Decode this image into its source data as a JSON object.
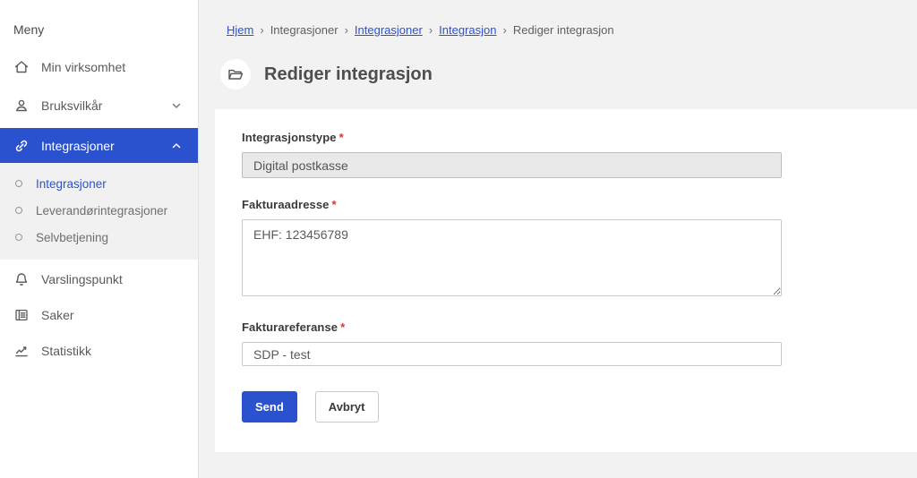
{
  "colors": {
    "accent": "#2b52ce",
    "required": "#e03131",
    "sidebar_active_bg": "#2b52ce",
    "main_background": "#f2f2f2",
    "disabled_input_bg": "#e9e9e9"
  },
  "sidebar": {
    "menu_label": "Meny",
    "items": [
      {
        "label": "Min virksomhet",
        "icon": "home-icon"
      },
      {
        "label": "Bruksvilkår",
        "icon": "person-icon",
        "chevron": "down"
      },
      {
        "label": "Integrasjoner",
        "icon": "link-icon",
        "chevron": "up",
        "active": true
      },
      {
        "label": "Varslingspunkt",
        "icon": "bell-icon"
      },
      {
        "label": "Saker",
        "icon": "list-icon"
      },
      {
        "label": "Statistikk",
        "icon": "chart-icon"
      }
    ],
    "submenu": [
      {
        "label": "Integrasjoner",
        "active": true
      },
      {
        "label": "Leverandørintegrasjoner",
        "active": false
      },
      {
        "label": "Selvbetjening",
        "active": false
      }
    ]
  },
  "breadcrumb": {
    "separator": "›",
    "items": [
      {
        "label": "Hjem",
        "link": true
      },
      {
        "label": "Integrasjoner",
        "link": false
      },
      {
        "label": "Integrasjoner",
        "link": true
      },
      {
        "label": "Integrasjon",
        "link": true
      },
      {
        "label": "Rediger integrasjon",
        "link": false
      }
    ]
  },
  "page": {
    "title": "Rediger integrasjon",
    "title_icon": "folder-open-icon"
  },
  "form": {
    "integrasjonstype": {
      "label": "Integrasjonstype",
      "required_marker": "*",
      "value": "Digital postkasse",
      "disabled": true
    },
    "fakturaadresse": {
      "label": "Fakturaadresse",
      "required_marker": "*",
      "value": "EHF: 123456789"
    },
    "fakturareferanse": {
      "label": "Fakturareferanse",
      "required_marker": "*",
      "value": "SDP - test"
    },
    "buttons": {
      "send": "Send",
      "cancel": "Avbryt"
    }
  }
}
